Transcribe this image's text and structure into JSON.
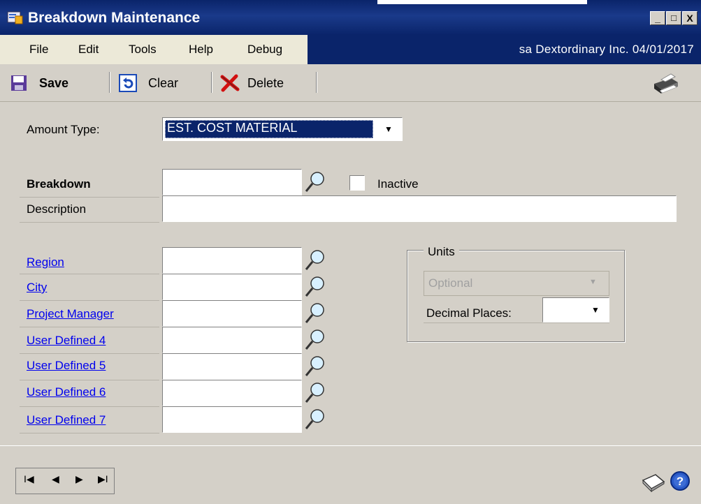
{
  "window": {
    "title": "Breakdown Maintenance",
    "minimize": "_",
    "maximize": "□",
    "close": "X"
  },
  "menu": {
    "items": [
      "File",
      "Edit",
      "Tools",
      "Help",
      "Debug"
    ],
    "status": "sa  Dextordinary Inc.  04/01/2017"
  },
  "toolbar": {
    "save_label": "Save",
    "clear_label": "Clear",
    "delete_label": "Delete"
  },
  "form": {
    "amount_type_label": "Amount Type:",
    "amount_type_value": "EST. COST MATERIAL",
    "breakdown_label": "Breakdown",
    "breakdown_value": "",
    "inactive_label": "Inactive",
    "inactive_checked": false,
    "description_label": "Description",
    "description_value": "",
    "links": [
      "Region",
      "City",
      "Project Manager",
      "User Defined 4",
      "User Defined 5",
      "User Defined 6",
      "User Defined 7"
    ],
    "link_values": [
      "",
      "",
      "",
      "",
      "",
      "",
      ""
    ]
  },
  "units": {
    "group_label": "Units",
    "optional_value": "Optional",
    "decimal_label": "Decimal Places:",
    "decimal_value": ""
  },
  "nav": {
    "first": "I◀",
    "prev": "◀",
    "next": "▶",
    "last": "▶I"
  },
  "colors": {
    "title_bar": "#0a246a",
    "link": "#0000ee",
    "selection": "#0a246a",
    "panel": "#d4d0c8"
  }
}
